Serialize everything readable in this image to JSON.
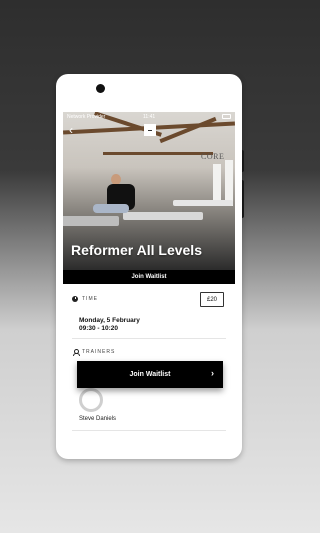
{
  "status_bar": {
    "carrier": "Network Provider",
    "time": "11:41"
  },
  "class": {
    "title": "Reformer All Levels",
    "studio_sign": "CORE",
    "join_waitlist_bar_label": "Join Waitlist"
  },
  "time_section": {
    "label": "TIME",
    "date": "Monday, 5 February",
    "time_range": "09:30 - 10:20",
    "price": "£20"
  },
  "trainers_section": {
    "label": "TRAINERS",
    "trainer_name": "Steve Daniels"
  },
  "cta": {
    "join_waitlist_label": "Join Waitlist",
    "chevron": "›"
  },
  "icons": {
    "back": "chevron-left-icon",
    "time": "clock-icon",
    "trainers": "person-icon"
  },
  "colors": {
    "accent": "#000000",
    "background_top": "#2e2e2e",
    "background_bottom": "#e6e6e6"
  }
}
